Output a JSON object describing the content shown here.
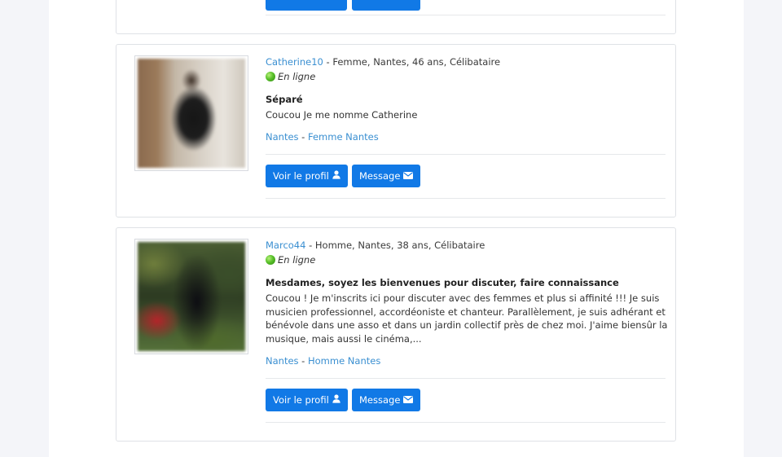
{
  "profiles": [
    {
      "username": "Catherine10",
      "details": " - Femme, Nantes, 46 ans, Célibataire",
      "status": "En ligne",
      "headline": "Séparé",
      "description": "Coucou Je me nomme Catherine",
      "city": "Nantes",
      "separator": " - ",
      "category": "Femme Nantes",
      "view_profile_label": "Voir le profil",
      "message_label": "Message"
    },
    {
      "username": "Marco44",
      "details": " - Homme, Nantes, 38 ans, Célibataire",
      "status": "En ligne",
      "headline": "Mesdames, soyez les bienvenues pour discuter, faire connaissance",
      "description": "Coucou ! Je m'inscrits ici pour discuter avec des femmes et plus si affinité !!! Je suis musicien professionnel, accordéoniste et chanteur. Parallèlement, je suis adhérant et bénévole dans une asso et dans un jardin collectif près de chez moi. J'aime biensûr la musique, mais aussi le cinéma,...",
      "city": "Nantes",
      "separator": " - ",
      "category": "Homme Nantes",
      "view_profile_label": "Voir le profil",
      "message_label": "Message"
    }
  ],
  "icons": {
    "status": "online-dot-icon",
    "view_profile": "user-icon",
    "message": "envelope-icon"
  },
  "colors": {
    "button": "#1179e6",
    "link": "#3a8fd1",
    "online": "#59c02a"
  }
}
